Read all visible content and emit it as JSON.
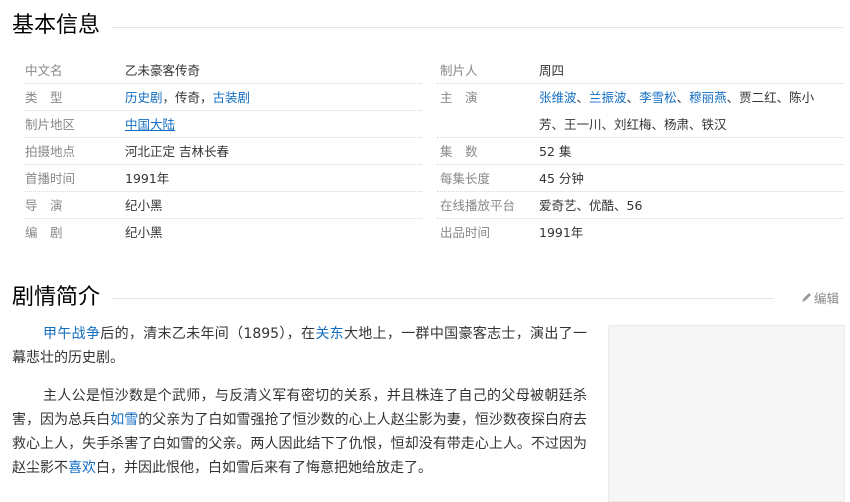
{
  "basic_info": {
    "title": "基本信息",
    "rows": [
      {
        "l_label": "中文名",
        "l_value": "乙未豪客传奇",
        "r_label": "制片人",
        "r_value": "周四"
      },
      {
        "l_label": "类　型",
        "l_value_parts": [
          "历史剧",
          "，传奇，",
          "古装剧"
        ],
        "r_label": "主　演",
        "r_cast": [
          "张维波",
          "、",
          "兰振波",
          "、",
          "李雪松",
          "、",
          "穆丽燕",
          "、贾二红、陈小"
        ]
      },
      {
        "l_label": "制片地区",
        "l_value": "中国大陆",
        "r_label": "",
        "r_value": "芳、王一川、刘红梅、杨肃、铁汉"
      },
      {
        "l_label": "拍摄地点",
        "l_value": "河北正定 吉林长春",
        "r_label": "集　数",
        "r_value": "52 集"
      },
      {
        "l_label": "首播时间",
        "l_value": "1991年",
        "r_label": "每集长度",
        "r_value": "45 分钟"
      },
      {
        "l_label": "导　演",
        "l_value": "纪小黑",
        "r_label": "在线播放平台",
        "r_value": "爱奇艺、优酷、56"
      },
      {
        "l_label": "编　剧",
        "l_value": "纪小黑",
        "r_label": "出品时间",
        "r_value": "1991年"
      }
    ]
  },
  "plot": {
    "title": "剧情简介",
    "edit_label": "编辑",
    "p1": [
      "甲午战争",
      "后的，清末乙未年间（1895），在",
      "关东",
      "大地上，一群中国豪客志士，演出了一幕悲壮的历史剧。"
    ],
    "p2": [
      "主人公是恒沙数是个武师，与反清义军有密切的关系，并且株连了自己的父母被朝廷杀害，因为总兵白",
      "如雪",
      "的父亲为了白如雪强抢了恒沙数的心上人赵尘影为妻，恒沙数夜探白府去救心上人，失手杀害了白如雪的父亲。两人因此结下了仇恨，恒却没有带走心上人。不过因为赵尘影不",
      "喜欢",
      "白，并因此恨他，白如雪后来有了悔意把她给放走了。"
    ]
  }
}
